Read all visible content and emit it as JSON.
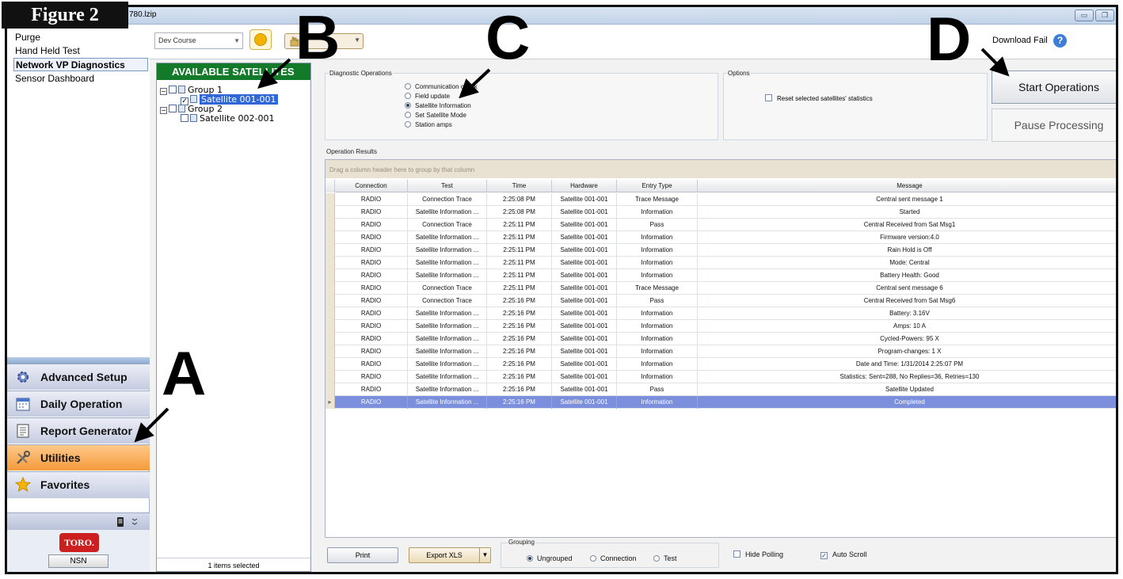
{
  "figure_label": "Figure 2",
  "window": {
    "title_fragment": "780.lzip",
    "minimize_glyph": "▭",
    "restore_glyph": "❐"
  },
  "nav": {
    "items": [
      "Purge",
      "Hand Held Test",
      "Network VP Diagnostics",
      "Sensor Dashboard"
    ],
    "selected": "Network VP Diagnostics",
    "big_buttons": [
      "Advanced Setup",
      "Daily Operation",
      "Report Generator",
      "Utilities",
      "Favorites"
    ],
    "active_button": "Utilities",
    "logo_text": "TORO.",
    "nsn_label": "NSN"
  },
  "toolbar": {
    "course": "Dev Course",
    "download_status": "Download Fail",
    "help_glyph": "?"
  },
  "satellites": {
    "header": "AVAILABLE SATELLITES",
    "tree": [
      {
        "label": "Group 1",
        "level": 0
      },
      {
        "label": "Satellite 001-001",
        "level": 1,
        "checked": true,
        "highlighted": true
      },
      {
        "label": "Group 2",
        "level": 0
      },
      {
        "label": "Satellite 002-001",
        "level": 1,
        "checked": false,
        "highlighted": false
      }
    ],
    "footer": "1 items selected"
  },
  "diagnostics": {
    "legend": "Diagnostic Operations",
    "options": [
      "Communication check",
      "Field update",
      "Satellite Information",
      "Set Satellite Mode",
      "Station amps"
    ],
    "selected": "Satellite Information",
    "options_legend": "Options",
    "reset_label": "Reset selected satellites' statistics",
    "start_label": "Start Operations",
    "pause_label": "Pause Processing"
  },
  "results": {
    "label": "Operation Results",
    "group_hint": "Drag a column header here to group by that column",
    "columns": [
      "Connection",
      "Test",
      "Time",
      "Hardware",
      "Entry Type",
      "Message"
    ],
    "rows": [
      [
        "RADIO",
        "Connection Trace",
        "2:25:08 PM",
        "Satellite 001-001",
        "Trace Message",
        "Central sent message 1"
      ],
      [
        "RADIO",
        "Satellite Information ...",
        "2:25:08 PM",
        "Satellite 001-001",
        "Information",
        "Started"
      ],
      [
        "RADIO",
        "Connection Trace",
        "2:25:11 PM",
        "Satellite 001-001",
        "Pass",
        "Central Received from Sat Msg1"
      ],
      [
        "RADIO",
        "Satellite Information ...",
        "2:25:11 PM",
        "Satellite 001-001",
        "Information",
        "Firmware version:4.0"
      ],
      [
        "RADIO",
        "Satellite Information ...",
        "2:25:11 PM",
        "Satellite 001-001",
        "Information",
        "Rain Hold is Off"
      ],
      [
        "RADIO",
        "Satellite Information ...",
        "2:25:11 PM",
        "Satellite 001-001",
        "Information",
        "Mode: Central"
      ],
      [
        "RADIO",
        "Satellite Information ...",
        "2:25:11 PM",
        "Satellite 001-001",
        "Information",
        "Battery Health: Good"
      ],
      [
        "RADIO",
        "Connection Trace",
        "2:25:11 PM",
        "Satellite 001-001",
        "Trace Message",
        "Central sent message 6"
      ],
      [
        "RADIO",
        "Connection Trace",
        "2:25:16 PM",
        "Satellite 001-001",
        "Pass",
        "Central Received from Sat Msg6"
      ],
      [
        "RADIO",
        "Satellite Information ...",
        "2:25:16 PM",
        "Satellite 001-001",
        "Information",
        "Battery:  3.16V"
      ],
      [
        "RADIO",
        "Satellite Information ...",
        "2:25:16 PM",
        "Satellite 001-001",
        "Information",
        "Amps:  10 A"
      ],
      [
        "RADIO",
        "Satellite Information ...",
        "2:25:16 PM",
        "Satellite 001-001",
        "Information",
        "Cycled-Powers:  95 X"
      ],
      [
        "RADIO",
        "Satellite Information ...",
        "2:25:16 PM",
        "Satellite 001-001",
        "Information",
        "Program-changes: 1 X"
      ],
      [
        "RADIO",
        "Satellite Information ...",
        "2:25:16 PM",
        "Satellite 001-001",
        "Information",
        "Date and Time: 1/31/2014 2:25:07 PM"
      ],
      [
        "RADIO",
        "Satellite Information ...",
        "2:25:16 PM",
        "Satellite 001-001",
        "Information",
        "Statistics: Sent=288, No Replies=36, Retries=130"
      ],
      [
        "RADIO",
        "Satellite Information ...",
        "2:25:16 PM",
        "Satellite 001-001",
        "Pass",
        "Satellite Updated"
      ],
      [
        "RADIO",
        "Satellite Information ...",
        "2:25:16 PM",
        "Satellite 001-001",
        "Information",
        "Completed"
      ]
    ],
    "selected_row": 16,
    "selected_row_marker": "▸"
  },
  "bottom": {
    "print_label": "Print",
    "export_label": "Export XLS",
    "grouping_legend": "Grouping",
    "grouping_options": [
      "Ungrouped",
      "Connection",
      "Test"
    ],
    "grouping_selected": "Ungrouped",
    "hide_polling_label": "Hide Polling",
    "hide_polling_checked": false,
    "auto_scroll_label": "Auto Scroll",
    "auto_scroll_checked": true
  },
  "annotations": [
    "A",
    "B",
    "C",
    "D"
  ]
}
